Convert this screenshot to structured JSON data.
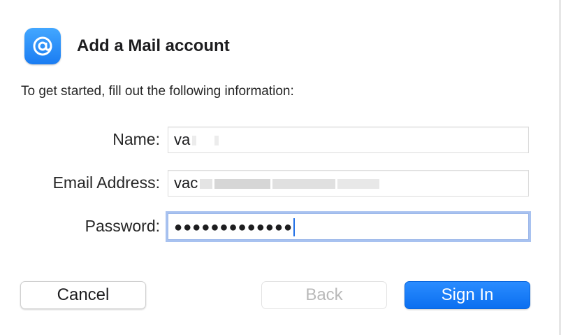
{
  "dialog": {
    "title": "Add a Mail account",
    "intro": "To get started, fill out the following information:",
    "icon": "at-sign-icon"
  },
  "form": {
    "name_label": "Name:",
    "name_value": "va",
    "email_label": "Email Address:",
    "email_value": "vac",
    "password_label": "Password:",
    "password_value": "●●●●●●●●●●●●●"
  },
  "buttons": {
    "cancel": "Cancel",
    "back": "Back",
    "sign_in": "Sign In"
  },
  "colors": {
    "accent": "#0b6ff0",
    "focus_ring": "#a8c2f0",
    "disabled_text": "#b9b9b9"
  }
}
